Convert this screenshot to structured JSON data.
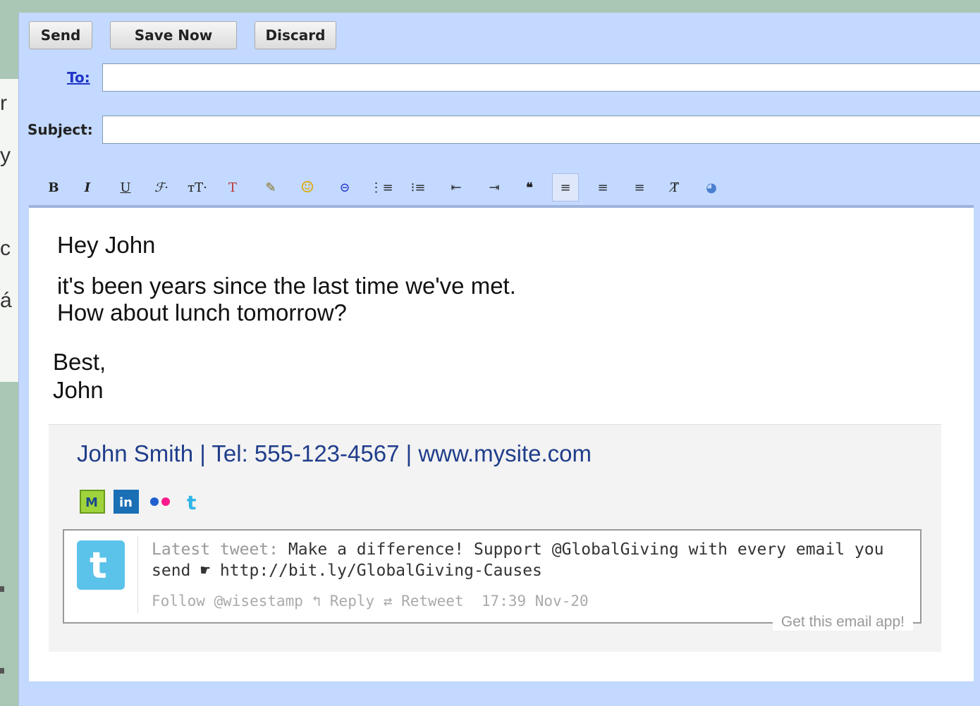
{
  "toolbar_buttons": {
    "send": "Send",
    "save": "Save Now",
    "discard": "Discard"
  },
  "fields": {
    "to_label": "To:",
    "to_value": "",
    "subject_label": "Subject:",
    "subject_value": ""
  },
  "format_toolbar": [
    {
      "name": "bold-icon",
      "glyph": "B"
    },
    {
      "name": "italic-icon",
      "glyph": "I"
    },
    {
      "name": "underline-icon",
      "glyph": "U"
    },
    {
      "name": "font-icon",
      "glyph": "ℱ·"
    },
    {
      "name": "font-size-icon",
      "glyph": "тT·"
    },
    {
      "name": "text-color-icon",
      "glyph": "T"
    },
    {
      "name": "highlight-icon",
      "glyph": "✎"
    },
    {
      "name": "emoji-icon",
      "glyph": "☺"
    },
    {
      "name": "link-icon",
      "glyph": "⊝"
    },
    {
      "name": "numbered-list-icon",
      "glyph": "⋮≡"
    },
    {
      "name": "bulleted-list-icon",
      "glyph": "⁝≡"
    },
    {
      "name": "indent-less-icon",
      "glyph": "⇤"
    },
    {
      "name": "indent-more-icon",
      "glyph": "⇥"
    },
    {
      "name": "quote-icon",
      "glyph": "❝"
    },
    {
      "name": "align-left-icon",
      "glyph": "≡"
    },
    {
      "name": "align-center-icon",
      "glyph": "≡"
    },
    {
      "name": "align-right-icon",
      "glyph": "≡"
    },
    {
      "name": "remove-formatting-icon",
      "glyph": "T̸"
    },
    {
      "name": "spell-check-icon",
      "glyph": "◕"
    }
  ],
  "message": {
    "greeting": "Hey John",
    "line1": "it's been years since the last time we've met.",
    "line2": "How about lunch tomorrow?",
    "closing": "Best,",
    "name": "John"
  },
  "signature": {
    "line": "John Smith | Tel: 555-123-4567 | www.mysite.com",
    "social_icons": [
      "myspace-icon",
      "linkedin-icon",
      "flickr-icon",
      "twitter-icon"
    ],
    "tweet": {
      "label": "Latest tweet:",
      "text": "Make a difference! Support @GlobalGiving with every email you send ☛ http://bit.ly/GlobalGiving-Causes",
      "follow": "Follow @wisestamp",
      "reply": "Reply",
      "retweet": "Retweet",
      "time": "17:39 Nov-20",
      "app_link": "Get this email app!"
    }
  }
}
